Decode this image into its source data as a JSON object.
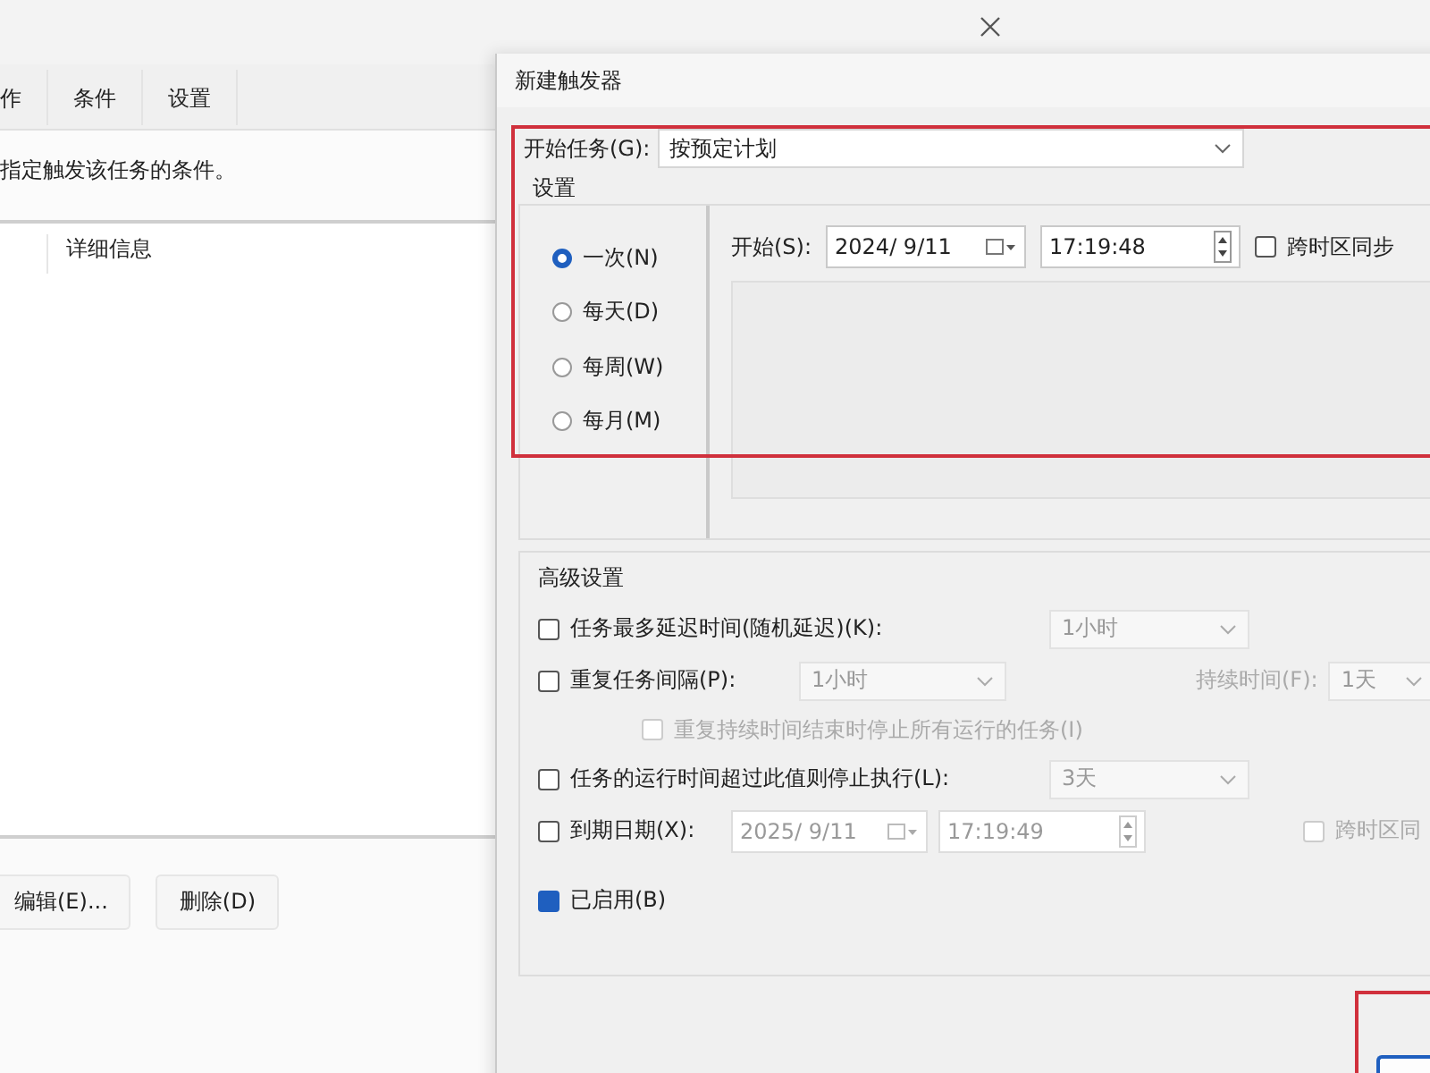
{
  "background_window": {
    "tabs": [
      {
        "label": "作",
        "selected": false
      },
      {
        "label": "条件",
        "selected": false
      },
      {
        "label": "设置",
        "selected": false
      }
    ],
    "description": "指定触发该任务的条件。",
    "table": {
      "columns": [
        "详细信息"
      ]
    },
    "buttons": [
      "编辑(E)...",
      "删除(D)"
    ]
  },
  "dialog": {
    "title": "新建触发器",
    "begin_task": {
      "label": "开始任务(G):",
      "value": "按预定计划"
    },
    "settings": {
      "title": "设置",
      "schedules": [
        {
          "label": "一次(N)",
          "selected": true
        },
        {
          "label": "每天(D)",
          "selected": false
        },
        {
          "label": "每周(W)",
          "selected": false
        },
        {
          "label": "每月(M)",
          "selected": false
        }
      ],
      "start": {
        "label": "开始(S):",
        "date": "2024/  9/11",
        "time": "17:19:48",
        "sync": {
          "label": "跨时区同步",
          "checked": false
        }
      }
    },
    "advanced": {
      "title": "高级设置",
      "rows": [
        {
          "kind": "main",
          "items": [
            {
              "kind": "checkbox",
              "label": "任务最多延迟时间(随机延迟)(K):",
              "checked": false,
              "disabled": false
            },
            {
              "kind": "combo",
              "value": "1小时",
              "disabled": true
            }
          ]
        },
        {
          "kind": "main",
          "items": [
            {
              "kind": "checkbox",
              "label": "重复任务间隔(P):",
              "checked": false,
              "disabled": false
            },
            {
              "kind": "combo",
              "value": "1小时",
              "disabled": true
            },
            {
              "kind": "label",
              "text": "持续时间(F):",
              "disabled": true
            },
            {
              "kind": "combo",
              "value": "1天",
              "disabled": true
            }
          ]
        },
        {
          "kind": "sub",
          "items": [
            {
              "kind": "checkbox",
              "label": "重复持续时间结束时停止所有运行的任务(I)",
              "checked": false,
              "disabled": true
            }
          ]
        },
        {
          "kind": "main",
          "items": [
            {
              "kind": "checkbox",
              "label": "任务的运行时间超过此值则停止执行(L):",
              "checked": false,
              "disabled": false
            },
            {
              "kind": "combo",
              "value": "3天",
              "disabled": true
            }
          ]
        },
        {
          "kind": "main",
          "items": [
            {
              "kind": "checkbox",
              "label": "到期日期(X):",
              "checked": false,
              "disabled": false
            },
            {
              "kind": "date",
              "value": "2025/  9/11",
              "disabled": true
            },
            {
              "kind": "time",
              "value": "17:19:49",
              "disabled": true
            },
            {
              "kind": "checkbox",
              "label": "跨时区同",
              "checked": false,
              "disabled": true
            }
          ]
        }
      ]
    },
    "enabled": {
      "label": "已启用(B)",
      "checked": true
    }
  }
}
